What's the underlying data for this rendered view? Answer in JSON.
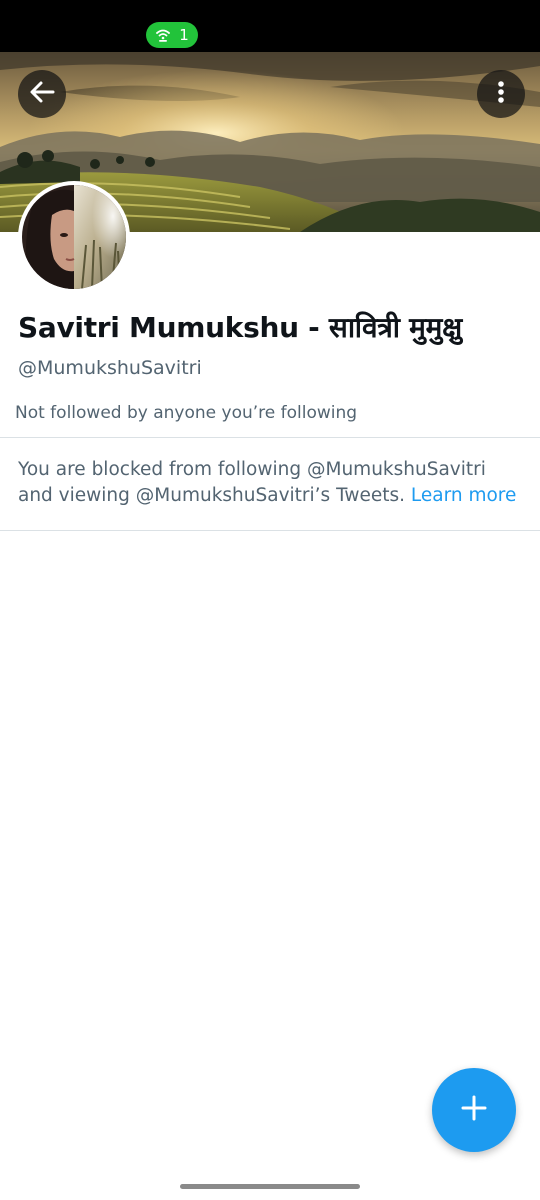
{
  "status_bar": {
    "hotspot_count": "1",
    "hotspot_icon": "wifi-hotspot-icon",
    "hotspot_color": "#22c33a"
  },
  "header": {
    "back_icon": "arrow-left-icon",
    "more_icon": "more-vertical-icon",
    "banner": "mountain-rice-terrace-sunset-image"
  },
  "profile": {
    "display_name": "Savitri Mumukshu - सावित्री मुमुक्षु",
    "handle": "@MumukshuSavitri",
    "followed_note": "Not followed by anyone you’re following",
    "avatar": "profile-photo"
  },
  "blocked": {
    "message": "You are blocked from following @MumukshuSavitri and viewing @MumukshuSavitri’s Tweets. ",
    "learn_more_label": "Learn more"
  },
  "fab": {
    "icon": "plus-icon",
    "color": "#1d9bf0"
  },
  "colors": {
    "text_primary": "#0f1419",
    "text_secondary": "#536471",
    "link": "#1d9bf0"
  }
}
